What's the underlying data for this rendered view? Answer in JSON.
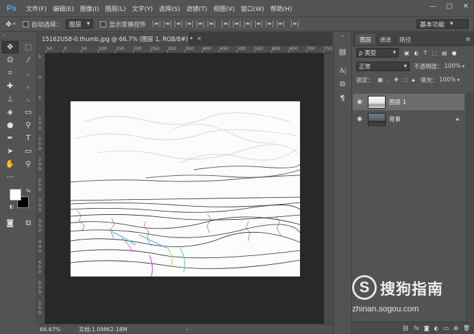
{
  "app": {
    "logo_text": "Ps"
  },
  "menu": [
    "文件(F)",
    "编辑(E)",
    "图像(I)",
    "图层(L)",
    "文字(Y)",
    "选择(S)",
    "滤镜(T)",
    "视图(V)",
    "窗口(W)",
    "帮助(H)"
  ],
  "window_controls": {
    "minimize": "—",
    "restore": "▢",
    "close": "✕"
  },
  "options": {
    "auto_select_label": "自动选择：",
    "auto_select_value": "图层",
    "show_transform_label": "显示变换控件",
    "workspace_value": "基本功能"
  },
  "document": {
    "tab_title": "15162US8-0.thumb.jpg @ 66.7% (图层 1, RGB/8#) *",
    "tab_close": "×",
    "zoom": "66.67%",
    "doc_info": "文档:1.09M/2.18M",
    "status_arrow": "›"
  },
  "ruler_h": [
    "50",
    "0",
    "50",
    "100",
    "150",
    "200",
    "250",
    "300",
    "350",
    "400",
    "450",
    "500",
    "550",
    "600",
    "650",
    "700",
    "750"
  ],
  "ruler_v": [
    "5",
    "0",
    "5",
    "1 0 0",
    "1 5 0",
    "2 0 0",
    "2 5 0",
    "3 0 0",
    "3 5 0",
    "4 0 0",
    "4 5 0",
    "5 0 0",
    "5 5 0"
  ],
  "layers_panel": {
    "tabs": [
      "图层",
      "通道",
      "路径"
    ],
    "filter_type": "ρ 类型",
    "blend_mode": "正常",
    "opacity_label": "不透明度：",
    "opacity_value": "100%",
    "lock_label": "锁定：",
    "fill_label": "填充：",
    "fill_value": "100%",
    "layers": [
      {
        "name": "图层 1",
        "selected": true,
        "locked": false
      },
      {
        "name": "背景",
        "selected": false,
        "locked": true
      }
    ],
    "footer_icons": [
      "link-icon",
      "fx-icon",
      "mask-icon",
      "adjustment-icon",
      "folder-icon",
      "new-layer-icon",
      "trash-icon"
    ]
  },
  "watermark": {
    "logo_letter": "S",
    "brand": "搜狗指南",
    "url": "zhinan.sogou.com"
  },
  "colors": {
    "ps_blue": "#3fa9f5",
    "ui_gray": "#535353",
    "pasteboard": "#282828",
    "foreground_color": "#ffffff",
    "background_color": "#000000"
  }
}
